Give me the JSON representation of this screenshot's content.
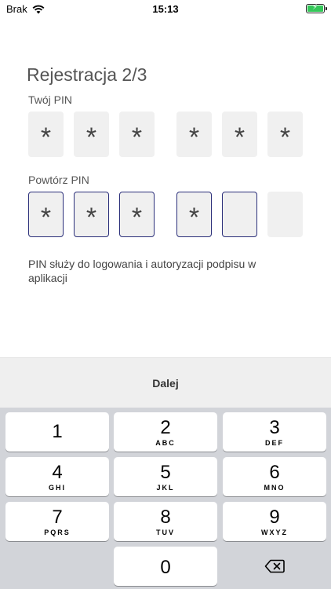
{
  "status_bar": {
    "carrier": "Brak",
    "time": "15:13"
  },
  "screen": {
    "title": "Rejestracja 2/3",
    "pin_label": "Twój PIN",
    "repeat_label": "Powtórz PIN",
    "pin_chars": [
      "*",
      "*",
      "*",
      "*",
      "*",
      "*"
    ],
    "repeat_chars": [
      "*",
      "*",
      "*",
      "*",
      "",
      ""
    ],
    "info_text": "PIN służy do logowania i autoryzacji podpisu w aplikacji"
  },
  "accessory": {
    "next_label": "Dalej"
  },
  "keyboard": {
    "keys": [
      {
        "digit": "1",
        "letters": ""
      },
      {
        "digit": "2",
        "letters": "ABC"
      },
      {
        "digit": "3",
        "letters": "DEF"
      },
      {
        "digit": "4",
        "letters": "GHI"
      },
      {
        "digit": "5",
        "letters": "JKL"
      },
      {
        "digit": "6",
        "letters": "MNO"
      },
      {
        "digit": "7",
        "letters": "PQRS"
      },
      {
        "digit": "8",
        "letters": "TUV"
      },
      {
        "digit": "9",
        "letters": "WXYZ"
      },
      {
        "digit": "0",
        "letters": ""
      }
    ],
    "backspace_icon": "backspace-icon"
  },
  "colors": {
    "active_border": "#2b2f7a",
    "battery": "#34c759",
    "keyboard_bg": "#d2d4d9"
  }
}
